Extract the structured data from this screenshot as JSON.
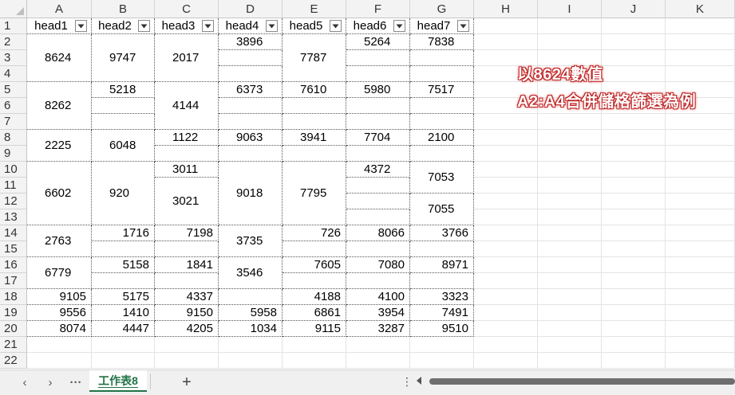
{
  "columns": [
    "A",
    "B",
    "C",
    "D",
    "E",
    "F",
    "G",
    "H",
    "I",
    "J",
    "K"
  ],
  "rows": [
    "1",
    "2",
    "3",
    "4",
    "5",
    "6",
    "7",
    "8",
    "9",
    "10",
    "11",
    "12",
    "13",
    "14",
    "15",
    "16",
    "17",
    "18",
    "19",
    "20",
    "21",
    "22"
  ],
  "headers": [
    "head1",
    "head2",
    "head3",
    "head4",
    "head5",
    "head6",
    "head7"
  ],
  "cells": {
    "A": [
      {
        "r": [
          2,
          4
        ],
        "v": "8624",
        "al": "ml"
      },
      {
        "r": [
          5,
          7
        ],
        "v": "8262",
        "al": "ml"
      },
      {
        "r": [
          8,
          9
        ],
        "v": "2225",
        "al": "ml"
      },
      {
        "r": [
          10,
          13
        ],
        "v": "6602",
        "al": "ml"
      },
      {
        "r": [
          14,
          15
        ],
        "v": "2763",
        "al": "ml"
      },
      {
        "r": [
          16,
          17
        ],
        "v": "6779",
        "al": "ml"
      },
      {
        "r": [
          18,
          18
        ],
        "v": "9105",
        "al": "mr"
      },
      {
        "r": [
          19,
          19
        ],
        "v": "9556",
        "al": "mr"
      },
      {
        "r": [
          20,
          20
        ],
        "v": "8074",
        "al": "mr"
      }
    ],
    "B": [
      {
        "r": [
          2,
          4
        ],
        "v": "9747",
        "al": "ml"
      },
      {
        "r": [
          5,
          5
        ],
        "v": "5218",
        "al": "ml"
      },
      {
        "r": [
          6,
          6
        ],
        "v": "",
        "al": "ml"
      },
      {
        "r": [
          7,
          7
        ],
        "v": "",
        "al": "ml"
      },
      {
        "r": [
          8,
          9
        ],
        "v": "6048",
        "al": "ml"
      },
      {
        "r": [
          10,
          13
        ],
        "v": "920",
        "al": "ml"
      },
      {
        "r": [
          14,
          14
        ],
        "v": "1716",
        "al": "mr"
      },
      {
        "r": [
          15,
          15
        ],
        "v": "",
        "al": "mr"
      },
      {
        "r": [
          16,
          16
        ],
        "v": "5158",
        "al": "mr"
      },
      {
        "r": [
          17,
          17
        ],
        "v": "",
        "al": "mr"
      },
      {
        "r": [
          18,
          18
        ],
        "v": "5175",
        "al": "mr"
      },
      {
        "r": [
          19,
          19
        ],
        "v": "1410",
        "al": "mr"
      },
      {
        "r": [
          20,
          20
        ],
        "v": "4447",
        "al": "mr"
      }
    ],
    "C": [
      {
        "r": [
          2,
          4
        ],
        "v": "2017",
        "al": "ml"
      },
      {
        "r": [
          5,
          7
        ],
        "v": "4144",
        "al": "ml"
      },
      {
        "r": [
          8,
          8
        ],
        "v": "1122",
        "al": "ml"
      },
      {
        "r": [
          9,
          9
        ],
        "v": "",
        "al": "ml"
      },
      {
        "r": [
          10,
          10
        ],
        "v": "3011",
        "al": "ml"
      },
      {
        "r": [
          11,
          13
        ],
        "v": "3021",
        "al": "ml"
      },
      {
        "r": [
          14,
          14
        ],
        "v": "7198",
        "al": "mr"
      },
      {
        "r": [
          15,
          15
        ],
        "v": "",
        "al": "mr"
      },
      {
        "r": [
          16,
          16
        ],
        "v": "1841",
        "al": "mr"
      },
      {
        "r": [
          17,
          17
        ],
        "v": "",
        "al": "mr"
      },
      {
        "r": [
          18,
          18
        ],
        "v": "4337",
        "al": "mr"
      },
      {
        "r": [
          19,
          19
        ],
        "v": "9150",
        "al": "mr"
      },
      {
        "r": [
          20,
          20
        ],
        "v": "4205",
        "al": "mr"
      }
    ],
    "D": [
      {
        "r": [
          2,
          2
        ],
        "v": "3896",
        "al": "ml"
      },
      {
        "r": [
          3,
          3
        ],
        "v": "",
        "al": "ml"
      },
      {
        "r": [
          4,
          4
        ],
        "v": "",
        "al": "ml"
      },
      {
        "r": [
          5,
          5
        ],
        "v": "6373",
        "al": "ml"
      },
      {
        "r": [
          6,
          6
        ],
        "v": "",
        "al": "ml"
      },
      {
        "r": [
          7,
          7
        ],
        "v": "",
        "al": "ml"
      },
      {
        "r": [
          8,
          8
        ],
        "v": "9063",
        "al": "ml"
      },
      {
        "r": [
          9,
          9
        ],
        "v": "",
        "al": "ml"
      },
      {
        "r": [
          10,
          13
        ],
        "v": "9018",
        "al": "ml"
      },
      {
        "r": [
          14,
          15
        ],
        "v": "3735",
        "al": "ml"
      },
      {
        "r": [
          16,
          17
        ],
        "v": "3546",
        "al": "ml"
      },
      {
        "r": [
          18,
          18
        ],
        "v": "",
        "al": "mr"
      },
      {
        "r": [
          19,
          19
        ],
        "v": "5958",
        "al": "mr"
      },
      {
        "r": [
          20,
          20
        ],
        "v": "1034",
        "al": "mr"
      }
    ],
    "E": [
      {
        "r": [
          2,
          4
        ],
        "v": "7787",
        "al": "ml"
      },
      {
        "r": [
          5,
          5
        ],
        "v": "7610",
        "al": "ml"
      },
      {
        "r": [
          6,
          6
        ],
        "v": "",
        "al": "ml"
      },
      {
        "r": [
          7,
          7
        ],
        "v": "",
        "al": "ml"
      },
      {
        "r": [
          8,
          8
        ],
        "v": "3941",
        "al": "ml"
      },
      {
        "r": [
          9,
          9
        ],
        "v": "",
        "al": "ml"
      },
      {
        "r": [
          10,
          13
        ],
        "v": "7795",
        "al": "ml"
      },
      {
        "r": [
          14,
          14
        ],
        "v": "726",
        "al": "mr"
      },
      {
        "r": [
          15,
          15
        ],
        "v": "",
        "al": "mr"
      },
      {
        "r": [
          16,
          16
        ],
        "v": "7605",
        "al": "mr"
      },
      {
        "r": [
          17,
          17
        ],
        "v": "",
        "al": "mr"
      },
      {
        "r": [
          18,
          18
        ],
        "v": "4188",
        "al": "mr"
      },
      {
        "r": [
          19,
          19
        ],
        "v": "6861",
        "al": "mr"
      },
      {
        "r": [
          20,
          20
        ],
        "v": "9115",
        "al": "mr"
      }
    ],
    "F": [
      {
        "r": [
          2,
          2
        ],
        "v": "5264",
        "al": "ml"
      },
      {
        "r": [
          3,
          3
        ],
        "v": "",
        "al": "ml"
      },
      {
        "r": [
          4,
          4
        ],
        "v": "",
        "al": "ml"
      },
      {
        "r": [
          5,
          5
        ],
        "v": "5980",
        "al": "ml"
      },
      {
        "r": [
          6,
          6
        ],
        "v": "",
        "al": "ml"
      },
      {
        "r": [
          7,
          7
        ],
        "v": "",
        "al": "ml"
      },
      {
        "r": [
          8,
          8
        ],
        "v": "7704",
        "al": "ml"
      },
      {
        "r": [
          9,
          9
        ],
        "v": "",
        "al": "ml"
      },
      {
        "r": [
          10,
          10
        ],
        "v": "4372",
        "al": "ml"
      },
      {
        "r": [
          11,
          11
        ],
        "v": "",
        "al": "ml"
      },
      {
        "r": [
          12,
          12
        ],
        "v": "",
        "al": "ml"
      },
      {
        "r": [
          13,
          13
        ],
        "v": "",
        "al": "ml"
      },
      {
        "r": [
          14,
          14
        ],
        "v": "8066",
        "al": "mr"
      },
      {
        "r": [
          15,
          15
        ],
        "v": "",
        "al": "mr"
      },
      {
        "r": [
          16,
          16
        ],
        "v": "7080",
        "al": "mr"
      },
      {
        "r": [
          17,
          17
        ],
        "v": "",
        "al": "mr"
      },
      {
        "r": [
          18,
          18
        ],
        "v": "4100",
        "al": "mr"
      },
      {
        "r": [
          19,
          19
        ],
        "v": "3954",
        "al": "mr"
      },
      {
        "r": [
          20,
          20
        ],
        "v": "3287",
        "al": "mr"
      }
    ],
    "G": [
      {
        "r": [
          2,
          2
        ],
        "v": "7838",
        "al": "ml"
      },
      {
        "r": [
          3,
          3
        ],
        "v": "",
        "al": "ml"
      },
      {
        "r": [
          4,
          4
        ],
        "v": "",
        "al": "ml"
      },
      {
        "r": [
          5,
          5
        ],
        "v": "7517",
        "al": "ml"
      },
      {
        "r": [
          6,
          6
        ],
        "v": "",
        "al": "ml"
      },
      {
        "r": [
          7,
          7
        ],
        "v": "",
        "al": "ml"
      },
      {
        "r": [
          8,
          8
        ],
        "v": "2100",
        "al": "ml"
      },
      {
        "r": [
          9,
          9
        ],
        "v": "",
        "al": "ml"
      },
      {
        "r": [
          10,
          11
        ],
        "v": "7053",
        "al": "ml"
      },
      {
        "r": [
          12,
          13
        ],
        "v": "7055",
        "al": "ml"
      },
      {
        "r": [
          14,
          14
        ],
        "v": "3766",
        "al": "mr"
      },
      {
        "r": [
          15,
          15
        ],
        "v": "",
        "al": "mr"
      },
      {
        "r": [
          16,
          16
        ],
        "v": "8971",
        "al": "mr"
      },
      {
        "r": [
          17,
          17
        ],
        "v": "",
        "al": "mr"
      },
      {
        "r": [
          18,
          18
        ],
        "v": "3323",
        "al": "mr"
      },
      {
        "r": [
          19,
          19
        ],
        "v": "7491",
        "al": "mr"
      },
      {
        "r": [
          20,
          20
        ],
        "v": "9510",
        "al": "mr"
      }
    ]
  },
  "note": {
    "line1": "以8624數值",
    "line2": "A2:A4合併儲格篩選為例"
  },
  "tabbar": {
    "prev": "‹",
    "next": "›",
    "more": "···",
    "sheet_name": "工作表8",
    "add": "+",
    "split": "⋮"
  },
  "colors": {
    "accent": "#217346",
    "note_outline": "#bb2222"
  },
  "icons": {
    "filter": "filter-dropdown-icon"
  }
}
